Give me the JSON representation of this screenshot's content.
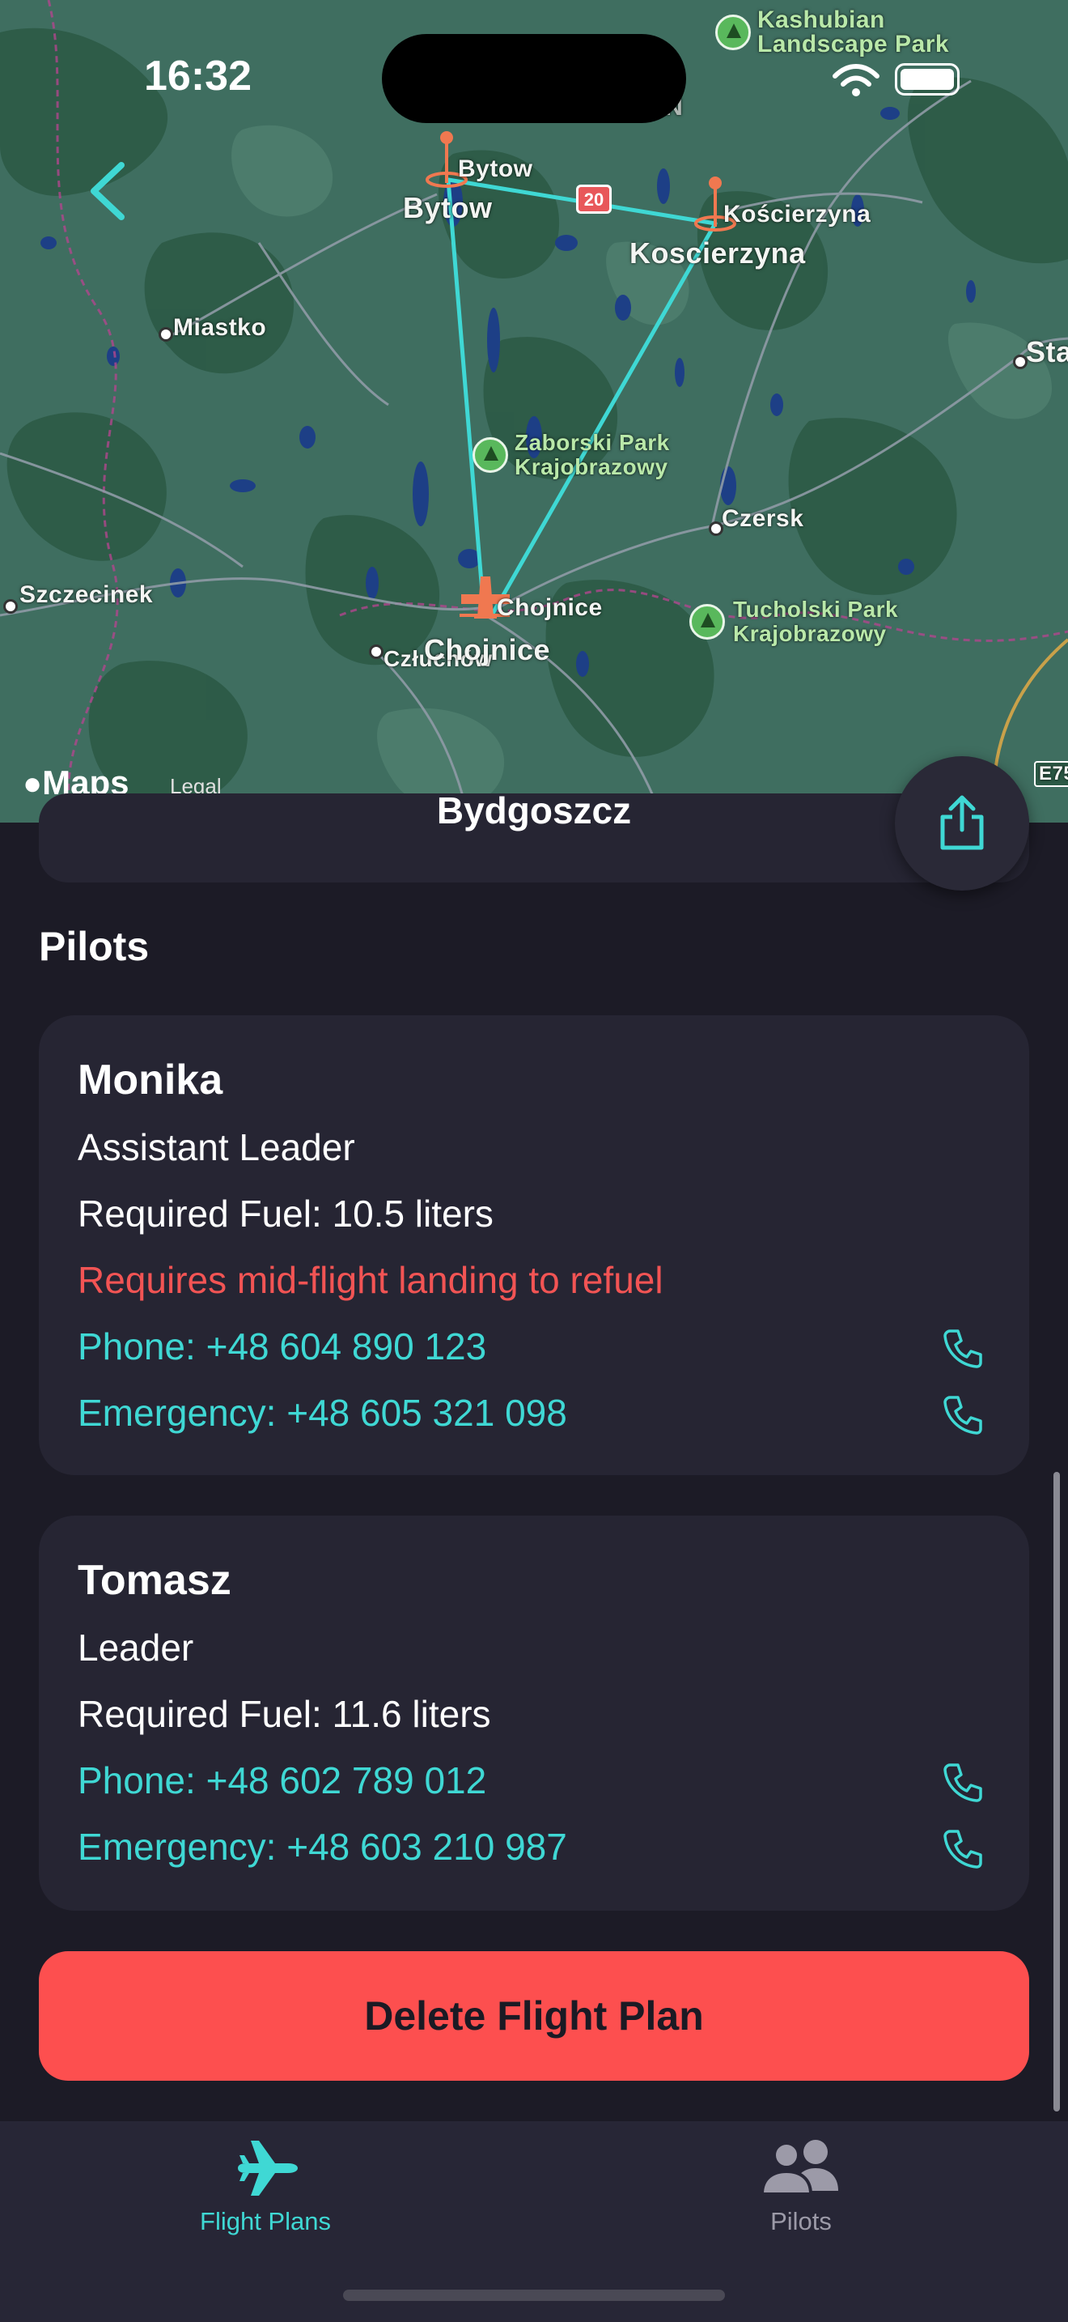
{
  "status_bar": {
    "time": "16:32"
  },
  "map": {
    "labels": {
      "kashubian": "Kashubian\nLandscape Park",
      "bytow_pin": "Bytow",
      "bytow": "Bytow",
      "koscierzyna_pin": "Kościerzyna",
      "koscierzyna": "Koscierzyna",
      "miastko": "Miastko",
      "sta": "Sta",
      "zaborski": "Zaborski Park\nKrajobrazowy",
      "czersk": "Czersk",
      "szczecinek": "Szczecinek",
      "chojnice_pin": "Chojnice",
      "czluchow": "Człuchów",
      "chojnice": "Chojnice",
      "tucholski": "Tucholski Park\nKrajobrazowy",
      "road_20": "20",
      "e75": "E75",
      "an": "AN"
    },
    "attribution": {
      "logo": "Maps",
      "legal": "Legal"
    }
  },
  "previous_card": {
    "text": "Bydgoszcz"
  },
  "section": {
    "pilots_title": "Pilots"
  },
  "pilots": [
    {
      "name": "Monika",
      "role": "Assistant Leader",
      "fuel": "Required Fuel: 10.5 liters",
      "warning": "Requires mid-flight landing to refuel",
      "phone": "Phone: +48 604 890 123",
      "emergency": "Emergency: +48 605 321 098"
    },
    {
      "name": "Tomasz",
      "role": "Leader",
      "fuel": "Required Fuel: 11.6 liters",
      "phone": "Phone: +48 602 789 012",
      "emergency": "Emergency: +48 603 210 987"
    }
  ],
  "actions": {
    "delete_label": "Delete Flight Plan"
  },
  "tabbar": {
    "tabs": [
      {
        "label": "Flight Plans",
        "icon": "airplane-icon",
        "active": true
      },
      {
        "label": "Pilots",
        "icon": "people-icon",
        "active": false
      }
    ]
  },
  "colors": {
    "accent": "#3fd8d4",
    "danger": "#fd4f4f",
    "warning_text": "#f25454",
    "background": "#1c1b26",
    "card": "#262533"
  }
}
